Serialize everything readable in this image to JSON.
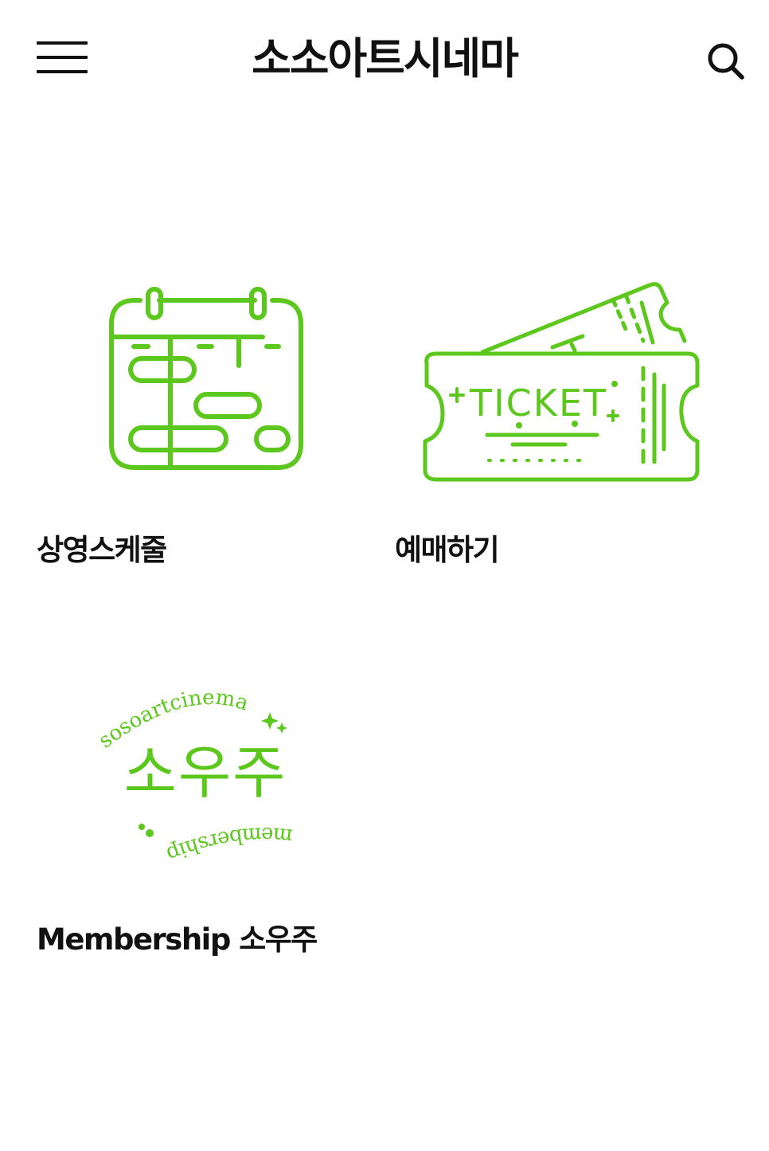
{
  "header": {
    "title": "소소아트시네마",
    "menu_icon": "hamburger-menu-icon",
    "search_icon": "search-icon"
  },
  "accent_color": "#5cc71c",
  "tiles": [
    {
      "label": "상영스케줄",
      "icon": "calendar-schedule-icon"
    },
    {
      "label": "예매하기",
      "icon": "ticket-icon",
      "icon_text": "TICKET"
    },
    {
      "label": "Membership 소우주",
      "icon": "membership-logo",
      "logo": {
        "top_text": "sosoartcinema",
        "center_text": "소우주",
        "bottom_text": "membership"
      }
    }
  ]
}
